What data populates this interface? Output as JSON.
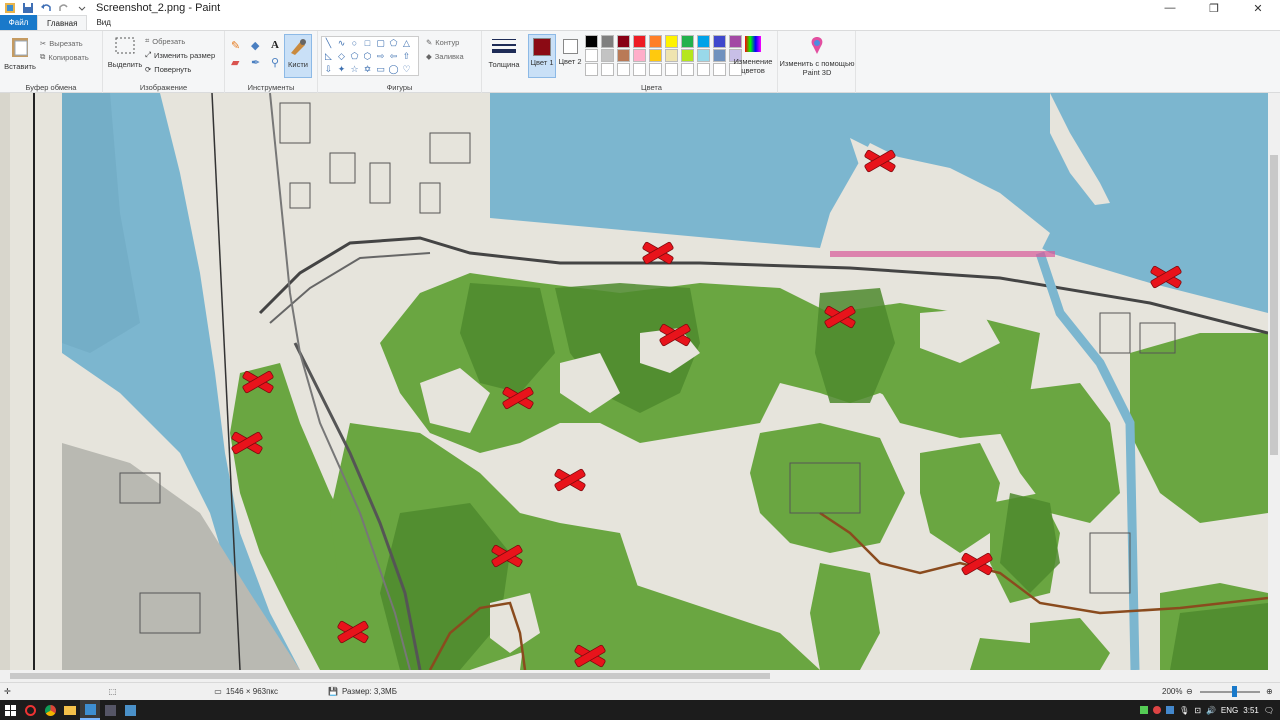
{
  "window": {
    "title": "Screenshot_2.png - Paint"
  },
  "tabs": [
    {
      "label": "Файл"
    },
    {
      "label": "Главная"
    },
    {
      "label": "Вид"
    }
  ],
  "ribbon": {
    "clipboard": {
      "paste": "Вставить",
      "cut": "Вырезать",
      "copy": "Копировать",
      "group": "Буфер обмена"
    },
    "image": {
      "select": "Выделить",
      "crop": "Обрезать",
      "resize": "Изменить размер",
      "rotate": "Повернуть",
      "group": "Изображение"
    },
    "tools": {
      "group": "Инструменты",
      "brushes": "Кисти"
    },
    "shapes": {
      "outline": "Контур",
      "fill": "Заливка",
      "group": "Фигуры"
    },
    "size": {
      "label": "Толщина"
    },
    "colors": {
      "color1": "Цвет 1",
      "color2": "Цвет 2",
      "edit": "Изменение цветов",
      "group": "Цвета",
      "color1_value": "#8b0a14",
      "color2_value": "#ffffff",
      "palette": [
        "#000000",
        "#7f7f7f",
        "#880015",
        "#ed1c24",
        "#ff7f27",
        "#fff200",
        "#22b14c",
        "#00a2e8",
        "#3f48cc",
        "#a349a4",
        "#ffffff",
        "#c3c3c3",
        "#b97a57",
        "#ffaec9",
        "#ffc90e",
        "#efe4b0",
        "#b5e61d",
        "#99d9ea",
        "#7092be",
        "#c8bfe7"
      ]
    },
    "paint3d": {
      "label": "Изменить с помощью Paint 3D"
    }
  },
  "status": {
    "dimensions": "1546 × 963пкс",
    "size": "Размер: 3,3МБ",
    "zoom": "200%"
  },
  "taskbar": {
    "lang": "ENG",
    "time": "3:51"
  },
  "map": {
    "marker_count": 16,
    "colors": {
      "water": "#7cb6cf",
      "forest": "#6aa641",
      "forest_dark": "#4e8a2e",
      "land": "#e6e4dc",
      "marker": "#e8131b"
    }
  }
}
